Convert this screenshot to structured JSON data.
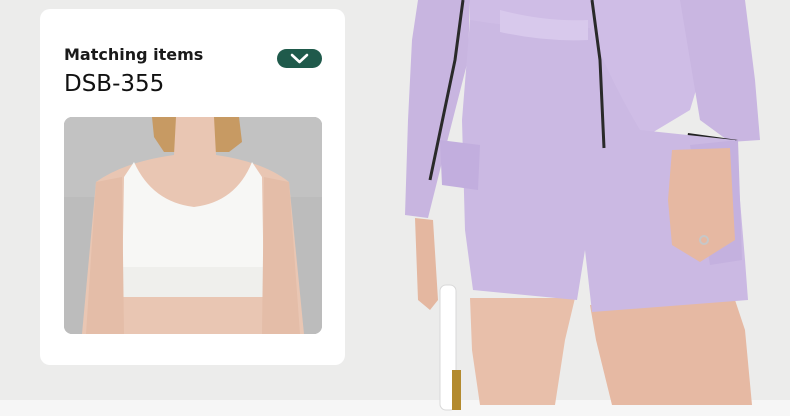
{
  "card": {
    "label": "Matching items",
    "code": "DSB-355"
  },
  "icons": {
    "toggle": "chevron-down-icon"
  },
  "colors": {
    "toggle_bg": "#1f5a4b",
    "lavender": "#cbb9e3"
  }
}
